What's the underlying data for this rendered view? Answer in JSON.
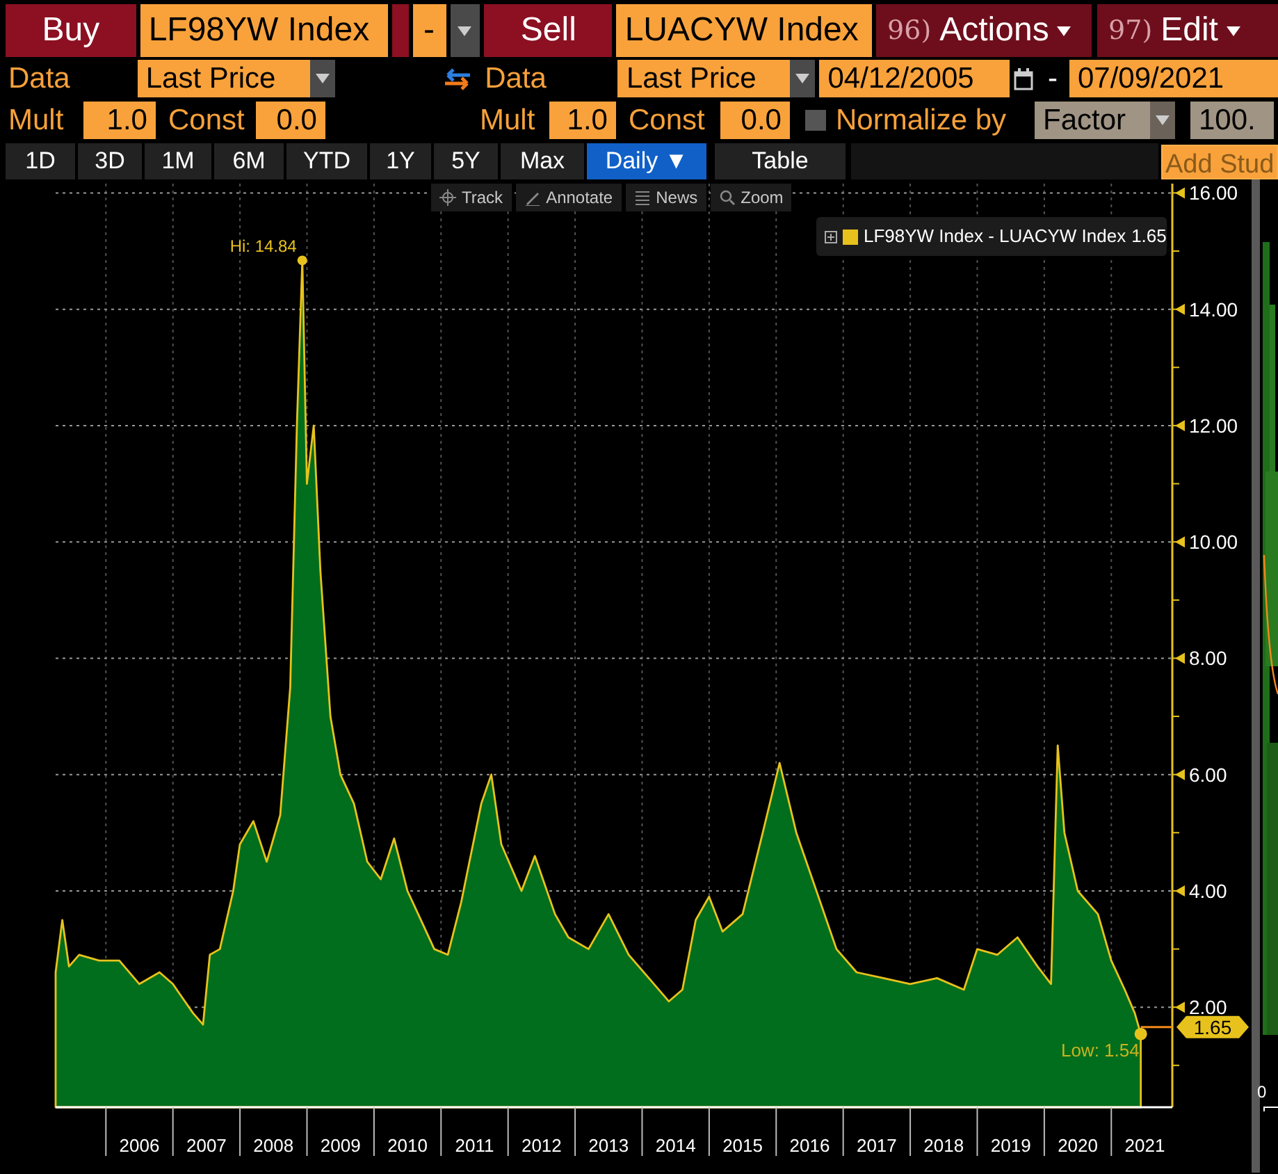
{
  "order_bar": {
    "buy": {
      "label": "Buy",
      "security": "LF98YW Index"
    },
    "operator": "-",
    "sell": {
      "label": "Sell",
      "security": "LUACYW Index"
    },
    "menus": [
      {
        "number": "96)",
        "label": "Actions"
      },
      {
        "number": "97)",
        "label": "Edit"
      }
    ]
  },
  "data_row": {
    "left": {
      "label": "Data",
      "field": "Last Price"
    },
    "right": {
      "label": "Data",
      "field": "Last Price"
    },
    "start_date": "04/12/2005",
    "separator": "-",
    "end_date": "07/09/2021"
  },
  "mult_row": {
    "left": {
      "mult_label": "Mult",
      "mult": "1.0",
      "const_label": "Const",
      "const": "0.0"
    },
    "right": {
      "mult_label": "Mult",
      "mult": "1.0",
      "const_label": "Const",
      "const": "0.0"
    },
    "normalize": {
      "label": "Normalize by",
      "checked": false,
      "method": "Factor",
      "value": "100."
    }
  },
  "periods": [
    {
      "label": "1D",
      "selected": false
    },
    {
      "label": "3D",
      "selected": false
    },
    {
      "label": "1M",
      "selected": false
    },
    {
      "label": "6M",
      "selected": false
    },
    {
      "label": "YTD",
      "selected": false
    },
    {
      "label": "1Y",
      "selected": false
    },
    {
      "label": "5Y",
      "selected": false
    },
    {
      "label": "Max",
      "selected": false
    },
    {
      "label": "Daily ▼",
      "selected": true
    }
  ],
  "table_button": "Table",
  "add_study": "Add Stud",
  "chart_tools": [
    "Track",
    "Annotate",
    "News",
    "Zoom"
  ],
  "chart": {
    "legend": {
      "value": "1.65",
      "color": "#e8c21c"
    },
    "last_value": "1.65",
    "chart_data": {
      "type": "area",
      "x": [
        2005.25,
        2005.35,
        2005.45,
        2005.6,
        2005.9,
        2006.2,
        2006.5,
        2006.8,
        2007.0,
        2007.3,
        2007.45,
        2007.55,
        2007.7,
        2007.9,
        2008.0,
        2008.2,
        2008.4,
        2008.6,
        2008.75,
        2008.85,
        2008.93,
        2009.0,
        2009.1,
        2009.2,
        2009.35,
        2009.5,
        2009.7,
        2009.9,
        2010.1,
        2010.3,
        2010.5,
        2010.7,
        2010.9,
        2011.1,
        2011.3,
        2011.6,
        2011.75,
        2011.9,
        2012.2,
        2012.4,
        2012.7,
        2012.9,
        2013.2,
        2013.5,
        2013.8,
        2014.1,
        2014.4,
        2014.6,
        2014.8,
        2015.0,
        2015.2,
        2015.5,
        2015.8,
        2016.05,
        2016.3,
        2016.6,
        2016.9,
        2017.2,
        2017.6,
        2018.0,
        2018.4,
        2018.8,
        2019.0,
        2019.3,
        2019.6,
        2019.9,
        2020.1,
        2020.2,
        2020.3,
        2020.5,
        2020.8,
        2021.0,
        2021.2,
        2021.35,
        2021.44
      ],
      "series": [
        {
          "name": "LF98YW Index - LUACYW Index",
          "color": "#006e1c",
          "values": [
            2.6,
            3.5,
            2.7,
            2.9,
            2.8,
            2.8,
            2.4,
            2.6,
            2.4,
            1.9,
            1.7,
            2.9,
            3.0,
            4.0,
            4.8,
            5.2,
            4.5,
            5.3,
            7.5,
            12.0,
            14.84,
            11.0,
            12.0,
            9.5,
            7.0,
            6.0,
            5.5,
            4.5,
            4.2,
            4.9,
            4.0,
            3.5,
            3.0,
            2.9,
            3.8,
            5.5,
            6.0,
            4.8,
            4.0,
            4.6,
            3.6,
            3.2,
            3.0,
            3.6,
            2.9,
            2.5,
            2.1,
            2.3,
            3.5,
            3.9,
            3.3,
            3.6,
            5.0,
            6.2,
            5.0,
            4.0,
            3.0,
            2.6,
            2.5,
            2.4,
            2.5,
            2.3,
            3.0,
            2.9,
            3.2,
            2.7,
            2.4,
            6.5,
            5.0,
            4.0,
            3.6,
            2.8,
            2.3,
            1.9,
            1.54
          ]
        }
      ],
      "xlim": [
        2005.25,
        2021.91
      ],
      "ylim": [
        0.28,
        16.16
      ],
      "grid": true,
      "yticks": [
        {
          "value": 2,
          "label": "2.00"
        },
        {
          "value": 4,
          "label": "4.00"
        },
        {
          "value": 6,
          "label": "6.00"
        },
        {
          "value": 8,
          "label": "8.00"
        },
        {
          "value": 10,
          "label": "10.00"
        },
        {
          "value": 12,
          "label": "12.00"
        },
        {
          "value": 14,
          "label": "14.00"
        },
        {
          "value": 16,
          "label": "16.00"
        }
      ],
      "xticks": [
        {
          "value": 2006.5,
          "label": "2006"
        },
        {
          "value": 2007.5,
          "label": "2007"
        },
        {
          "value": 2008.5,
          "label": "2008"
        },
        {
          "value": 2009.5,
          "label": "2009"
        },
        {
          "value": 2010.5,
          "label": "2010"
        },
        {
          "value": 2011.5,
          "label": "2011"
        },
        {
          "value": 2012.5,
          "label": "2012"
        },
        {
          "value": 2013.5,
          "label": "2013"
        },
        {
          "value": 2014.5,
          "label": "2014"
        },
        {
          "value": 2015.5,
          "label": "2015"
        },
        {
          "value": 2016.5,
          "label": "2016"
        },
        {
          "value": 2017.5,
          "label": "2017"
        },
        {
          "value": 2018.5,
          "label": "2018"
        },
        {
          "value": 2019.5,
          "label": "2019"
        },
        {
          "value": 2020.5,
          "label": "2020"
        },
        {
          "value": 2021.5,
          "label": "2021"
        }
      ],
      "annotations": [
        {
          "text": "Hi: 14.84",
          "x": 2008.93,
          "y": 14.84
        },
        {
          "text": "Low: 1.54",
          "x": 2021.44,
          "y": 1.54
        }
      ]
    }
  },
  "distribution_panel": {
    "axis_label": "0"
  }
}
